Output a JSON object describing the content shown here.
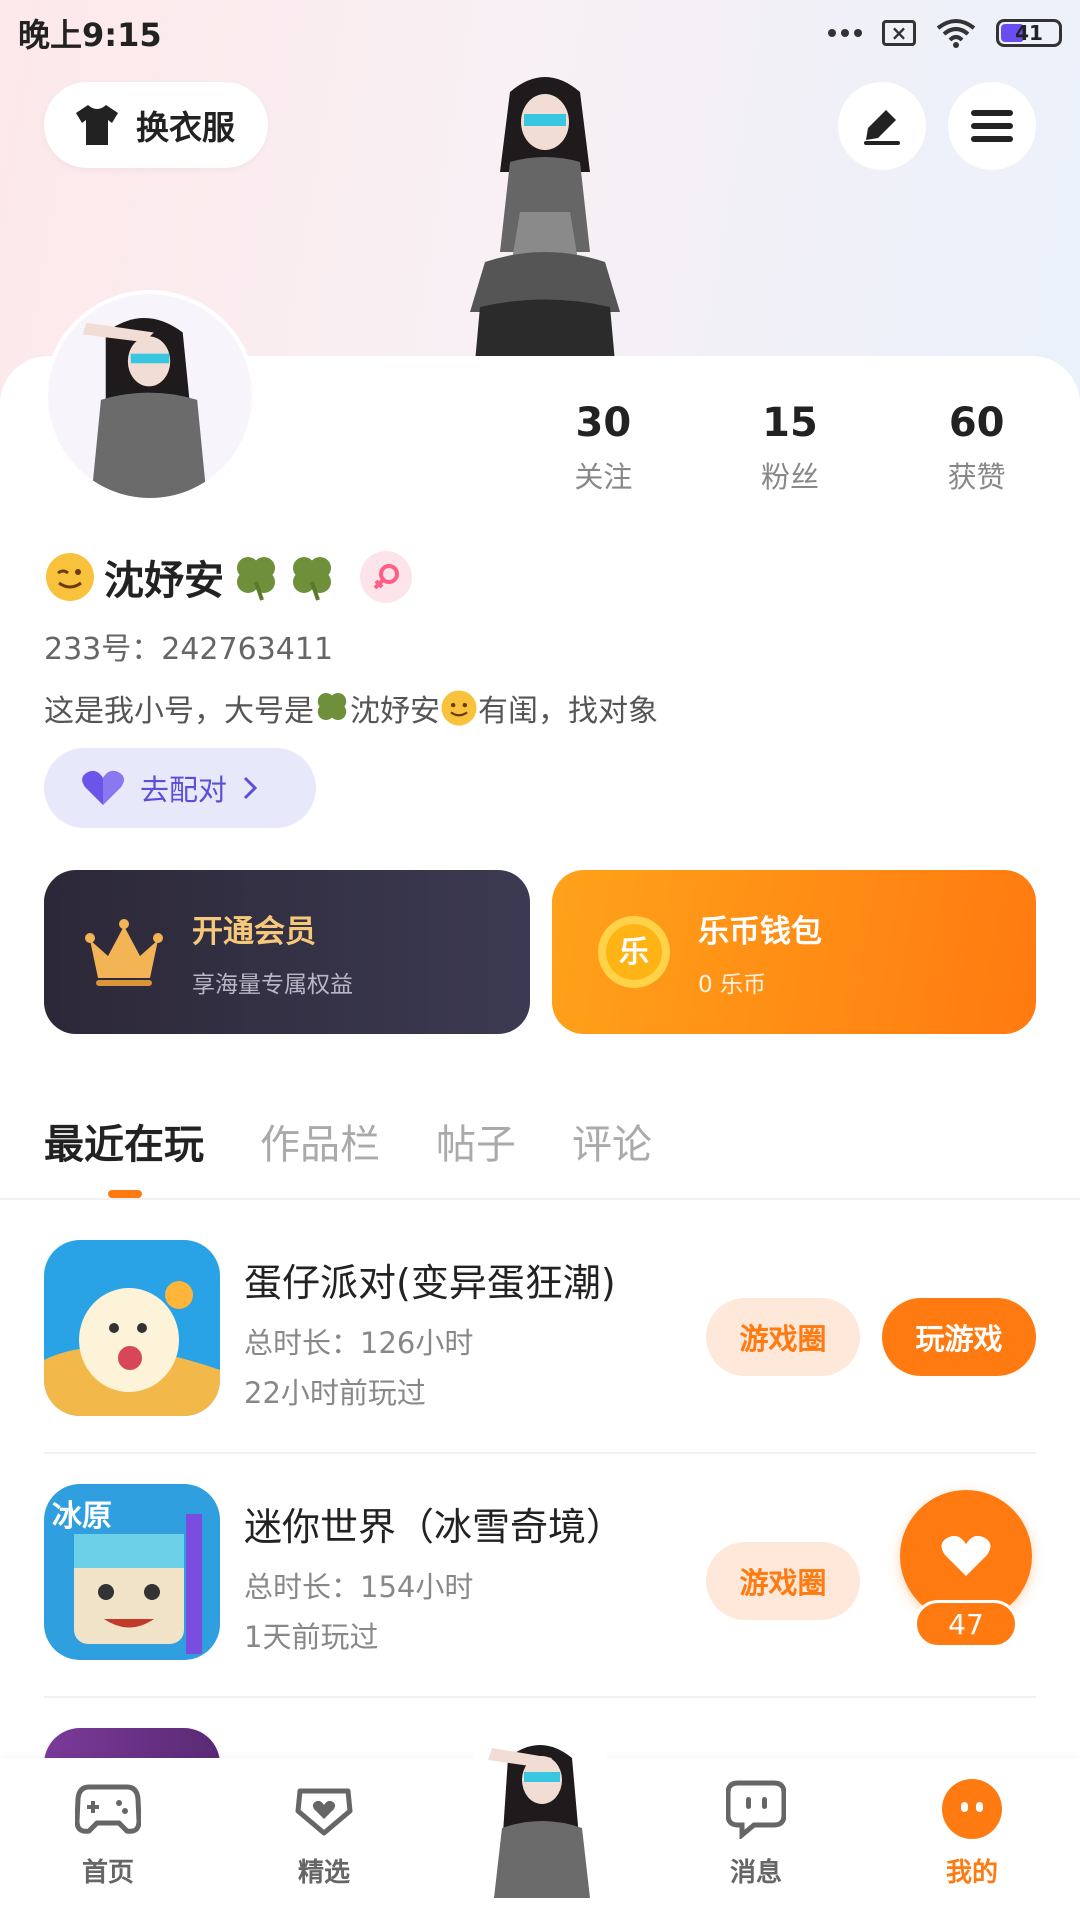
{
  "status_bar": {
    "time": "晚上9:15",
    "battery": "41"
  },
  "header": {
    "dress_label": "换衣服"
  },
  "stats": [
    {
      "num": "30",
      "label": "关注"
    },
    {
      "num": "15",
      "label": "粉丝"
    },
    {
      "num": "60",
      "label": "获赞"
    }
  ],
  "profile": {
    "name": "沈妤安",
    "uid": "233号：242763411",
    "bio_part1": "这是我小号，大号是",
    "bio_name": "沈妤安",
    "bio_part2": "有闺，找对象",
    "match_label": "去配对"
  },
  "vip": {
    "title": "开通会员",
    "subtitle": "享海量专属权益"
  },
  "wallet": {
    "title": "乐币钱包",
    "subtitle": "0 乐币",
    "coin_char": "乐"
  },
  "tabs": [
    "最近在玩",
    "作品栏",
    "帖子",
    "评论"
  ],
  "games": [
    {
      "title": "蛋仔派对(变异蛋狂潮)",
      "total": "总时长：126小时",
      "last": "22小时前玩过",
      "circle": "游戏圈",
      "play": "玩游戏"
    },
    {
      "title": "迷你世界（冰雪奇境）",
      "total": "总时长：154小时",
      "last": "1天前玩过",
      "circle": "游戏圈",
      "icon_text": "冰原"
    }
  ],
  "like": {
    "count": "47"
  },
  "nav": [
    {
      "label": "首页"
    },
    {
      "label": "精选"
    },
    {
      "label": "消息"
    },
    {
      "label": "我的"
    }
  ],
  "colors": {
    "accent": "#ff7a10",
    "match": "#5a4fd8",
    "vip_gold": "#f6c87a"
  }
}
